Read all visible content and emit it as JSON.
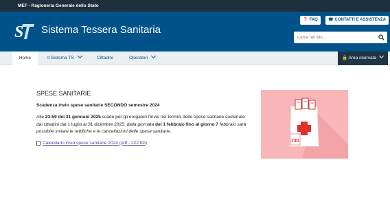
{
  "topbar": {
    "org": "MEF - Ragioneria Generale dello Stato"
  },
  "header": {
    "title": "Sistema Tessera Sanitaria",
    "faq_label": "FAQ",
    "contacts_label": "CONTATTI E ASSISTENZA",
    "search_placeholder": "Cerca nel sito..."
  },
  "nav": {
    "items": [
      {
        "label": "Home"
      },
      {
        "label": "Il Sistema TS"
      },
      {
        "label": "Cittadini"
      },
      {
        "label": "Operatori"
      }
    ],
    "reserved_area": "Area riservata"
  },
  "main": {
    "heading": "SPESE SANITARIE",
    "subheading": "Scadenza invio spese sanitarie SECONDO semestre 2024",
    "para_1_a": "Alle ",
    "para_1_b": "23:59 del 31 gennaio 2025",
    "para_1_c": " scade per gli erogatori l'invio nei termini delle spese sanitarie sostenute dai cittadini dal 1 luglio al 31 dicembre 2025; ",
    "para_1_d": "dalla giornata",
    "para_1_e": " del 1 febbraio fino al giorno 7",
    "para_1_f": " febbraio sarà possibile inviare le rettifiche e le cancellazioni delle spese sanitarie.",
    "link_label": "Calendario invio spese sanitarie 2024 (pdf - 222 Kb)"
  },
  "illustration": {
    "calendar_text": "730"
  },
  "colors": {
    "header": "#00528a",
    "topbar": "#1e2f3d",
    "nav": "#ebeff1",
    "reserved": "#1f3547",
    "illustration_bg": "#f9b6b8"
  }
}
